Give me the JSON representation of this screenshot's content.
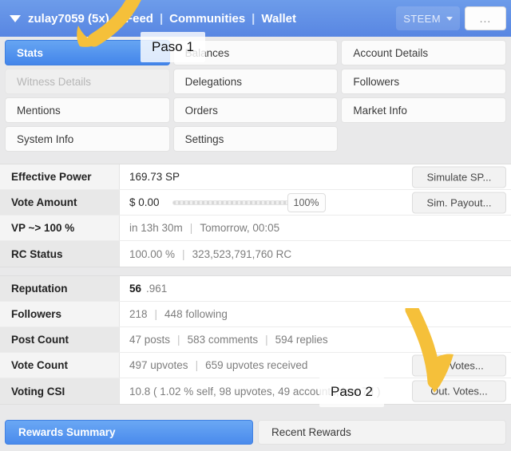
{
  "navbar": {
    "caret_icon": "chevron-down-icon",
    "username": "zulay7059 (5x)",
    "links": [
      "Feed",
      "Communities",
      "Wallet"
    ],
    "separator": "|",
    "token": "STEEM",
    "token_caret_icon": "caret-down-icon",
    "more_label": "...",
    "background_color": "#5886e2"
  },
  "tabs": [
    {
      "label": "Stats",
      "state": "active"
    },
    {
      "label": "Balances",
      "state": "normal"
    },
    {
      "label": "Account Details",
      "state": "normal"
    },
    {
      "label": "Witness Details",
      "state": "disabled"
    },
    {
      "label": "Delegations",
      "state": "normal"
    },
    {
      "label": "Followers",
      "state": "normal"
    },
    {
      "label": "Mentions",
      "state": "normal"
    },
    {
      "label": "Orders",
      "state": "normal"
    },
    {
      "label": "Market Info",
      "state": "normal"
    },
    {
      "label": "System Info",
      "state": "normal"
    },
    {
      "label": "Settings",
      "state": "normal"
    },
    {
      "label": "",
      "state": "empty"
    }
  ],
  "stats_top": [
    {
      "key": "Effective Power",
      "value": "169.73 SP",
      "button": "Simulate SP..."
    },
    {
      "key": "Vote Amount",
      "value": "$ 0.00",
      "slider_percent": "100%",
      "slider_value": 100,
      "button": "Sim. Payout..."
    },
    {
      "key": "VP ~> 100 %",
      "value_a": "in 13h 30m",
      "separator": "|",
      "value_b": "Tomorrow, 00:05"
    },
    {
      "key": "RC Status",
      "value_a": "100.00 %",
      "separator": "|",
      "value_b": "323,523,791,760 RC"
    }
  ],
  "stats_bottom": [
    {
      "key": "Reputation",
      "value_strong": "56",
      "value_rest": ".961"
    },
    {
      "key": "Followers",
      "value_a": "218",
      "separator": "|",
      "value_b": "448 following"
    },
    {
      "key": "Post Count",
      "value_a": "47 posts",
      "separator": "|",
      "value_b": "583 comments",
      "separator2": "|",
      "value_c": "594 replies"
    },
    {
      "key": "Vote Count",
      "value_a": "497 upvotes",
      "separator": "|",
      "value_b": "659 upvotes received",
      "button": "In. Votes..."
    },
    {
      "key": "Voting CSI",
      "value": "10.8 ( 1.02 % self, 98 upvotes, 49 accounts, last 7d )",
      "button": "Out. Votes..."
    }
  ],
  "bottom_tabs": [
    {
      "label": "Rewards Summary",
      "state": "active"
    },
    {
      "label": "Recent Rewards",
      "state": "normal"
    }
  ],
  "annotations": {
    "arrow_color": "#f5c03a",
    "step1": "Paso 1",
    "step2": "Paso 2"
  }
}
